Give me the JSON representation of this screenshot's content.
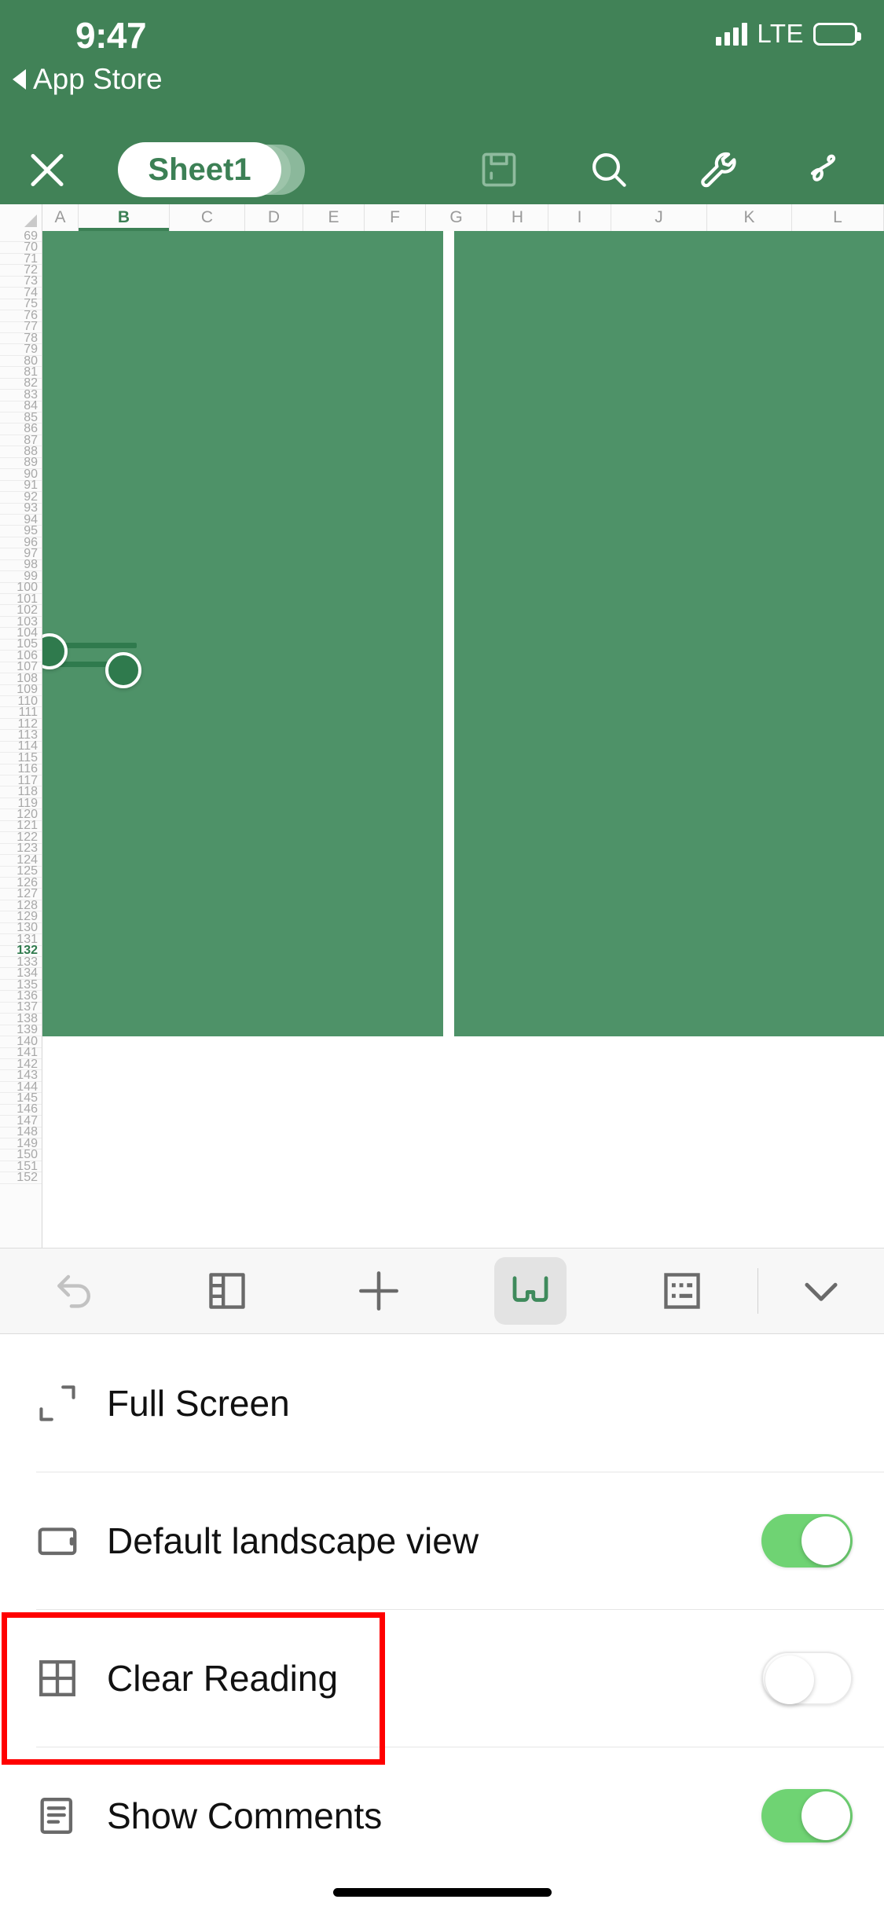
{
  "status_bar": {
    "time": "9:47",
    "back_label": "App Store",
    "carrier_tech": "LTE",
    "signal_icon": "signal-bars-icon",
    "battery_icon": "battery-full-icon"
  },
  "toolbar": {
    "close_icon": "close-icon",
    "sheet_tab_label": "Sheet1",
    "icons": [
      {
        "name": "save-icon",
        "label": "Save",
        "enabled": false
      },
      {
        "name": "search-icon",
        "label": "Search",
        "enabled": true
      },
      {
        "name": "wrench-icon",
        "label": "Tools",
        "enabled": true
      },
      {
        "name": "scribble-icon",
        "label": "Ink Annotation",
        "enabled": true
      }
    ]
  },
  "spreadsheet": {
    "columns": [
      "A",
      "B",
      "C",
      "D",
      "E",
      "F",
      "G",
      "H",
      "I",
      "J",
      "K",
      "L"
    ],
    "selected_column": "B",
    "row_start": 69,
    "row_end": 152,
    "selected_row": 132,
    "cell_fill_color": "#4e9268",
    "selection_color": "#2f7a4d",
    "select_all_icon": "select-all-corner-icon"
  },
  "action_bar": {
    "items": [
      {
        "name": "undo-icon",
        "label": "Undo",
        "enabled": false,
        "active": false
      },
      {
        "name": "split-view-icon",
        "label": "Split View",
        "enabled": true,
        "active": false
      },
      {
        "name": "plus-icon",
        "label": "Insert",
        "enabled": true,
        "active": false
      },
      {
        "name": "reading-glasses-icon",
        "label": "Reading Mode",
        "enabled": true,
        "active": true
      },
      {
        "name": "cell-format-icon",
        "label": "Cell Format",
        "enabled": true,
        "active": false
      },
      {
        "name": "chevron-down-icon",
        "label": "Collapse",
        "enabled": true,
        "active": false
      }
    ]
  },
  "settings": {
    "rows": [
      {
        "icon": "fullscreen-icon",
        "label": "Full Screen",
        "toggle": null
      },
      {
        "icon": "tablet-icon",
        "label": "Default landscape view",
        "toggle": "on"
      },
      {
        "icon": "grid-icon",
        "label": "Clear Reading",
        "toggle": "off"
      },
      {
        "icon": "comment-lines-icon",
        "label": "Show Comments",
        "toggle": "on"
      }
    ]
  },
  "annotation": {
    "highlight_color": "#ff0000",
    "target_label": "Default landscape view"
  },
  "theme": {
    "brand_green": "#418257",
    "cell_green": "#4e9268",
    "toggle_on_green": "#6fd373",
    "accent_text_green": "#3c8055"
  },
  "home_indicator": "home-indicator-bar"
}
